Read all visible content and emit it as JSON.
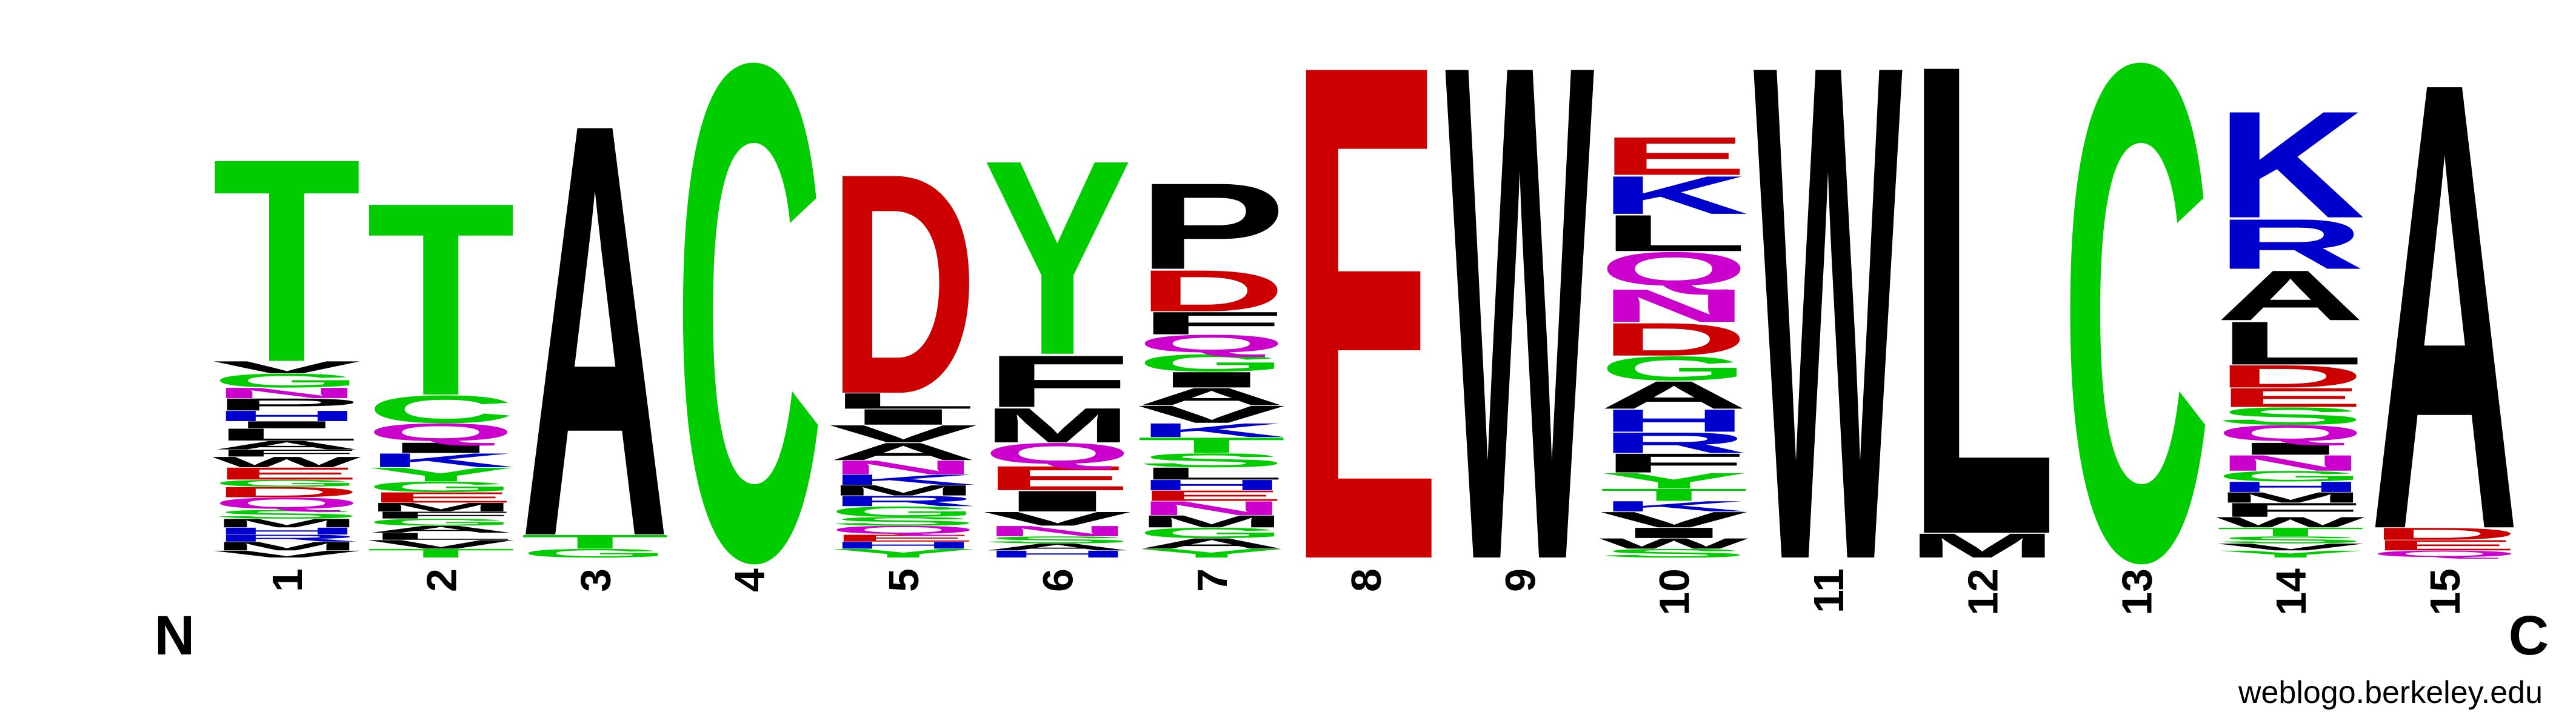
{
  "logo": {
    "n_terminus": "N",
    "c_terminus": "C",
    "credit": "weblogo.berkeley.edu",
    "colors": {
      "hydrophobic": "#000000",
      "polar": "#00cc00",
      "acidic": "#cc0000",
      "basic": "#0000cc",
      "amide": "#cc00cc"
    },
    "color_map": {
      "A": "#000000",
      "V": "#000000",
      "L": "#000000",
      "I": "#000000",
      "P": "#000000",
      "W": "#000000",
      "F": "#000000",
      "M": "#000000",
      "G": "#00cc00",
      "S": "#00cc00",
      "T": "#00cc00",
      "Y": "#00cc00",
      "C": "#00cc00",
      "D": "#cc0000",
      "E": "#cc0000",
      "K": "#0000cc",
      "R": "#0000cc",
      "H": "#0000cc",
      "N": "#cc00cc",
      "Q": "#cc00cc"
    },
    "positions": [
      {
        "label": "1",
        "stack": [
          {
            "aa": "V",
            "h": 0.04
          },
          {
            "aa": "M",
            "h": 0.05
          },
          {
            "aa": "R",
            "h": 0.04
          },
          {
            "aa": "H",
            "h": 0.04
          },
          {
            "aa": "M",
            "h": 0.05
          },
          {
            "aa": "S",
            "h": 0.05
          },
          {
            "aa": "Q",
            "h": 0.07
          },
          {
            "aa": "D",
            "h": 0.06
          },
          {
            "aa": "G",
            "h": 0.04
          },
          {
            "aa": "E",
            "h": 0.07
          },
          {
            "aa": "W",
            "h": 0.06
          },
          {
            "aa": "F",
            "h": 0.04
          },
          {
            "aa": "A",
            "h": 0.05
          },
          {
            "aa": "L",
            "h": 0.07
          },
          {
            "aa": "I",
            "h": 0.04
          },
          {
            "aa": "H",
            "h": 0.06
          },
          {
            "aa": "P",
            "h": 0.07
          },
          {
            "aa": "N",
            "h": 0.06
          },
          {
            "aa": "G",
            "h": 0.08
          },
          {
            "aa": "V",
            "h": 0.07
          },
          {
            "aa": "T",
            "h": 1.18
          }
        ]
      },
      {
        "label": "2",
        "stack": [
          {
            "aa": "T",
            "h": 0.05
          },
          {
            "aa": "V",
            "h": 0.05
          },
          {
            "aa": "L",
            "h": 0.04
          },
          {
            "aa": "A",
            "h": 0.04
          },
          {
            "aa": "G",
            "h": 0.04
          },
          {
            "aa": "F",
            "h": 0.04
          },
          {
            "aa": "M",
            "h": 0.05
          },
          {
            "aa": "E",
            "h": 0.06
          },
          {
            "aa": "G",
            "h": 0.06
          },
          {
            "aa": "Y",
            "h": 0.08
          },
          {
            "aa": "K",
            "h": 0.08
          },
          {
            "aa": "I",
            "h": 0.06
          },
          {
            "aa": "Q",
            "h": 0.11
          },
          {
            "aa": "C",
            "h": 0.16
          },
          {
            "aa": "T",
            "h": 1.12
          }
        ]
      },
      {
        "label": "3",
        "stack": [
          {
            "aa": "G",
            "h": 0.05
          },
          {
            "aa": "T",
            "h": 0.08
          },
          {
            "aa": "A",
            "h": 2.4
          }
        ]
      },
      {
        "label": "4",
        "stack": [
          {
            "aa": "C",
            "h": 2.88
          }
        ]
      },
      {
        "label": "5",
        "stack": [
          {
            "aa": "Y",
            "h": 0.05
          },
          {
            "aa": "H",
            "h": 0.04
          },
          {
            "aa": "E",
            "h": 0.04
          },
          {
            "aa": "Q",
            "h": 0.05
          },
          {
            "aa": "S",
            "h": 0.05
          },
          {
            "aa": "G",
            "h": 0.06
          },
          {
            "aa": "R",
            "h": 0.06
          },
          {
            "aa": "M",
            "h": 0.06
          },
          {
            "aa": "K",
            "h": 0.06
          },
          {
            "aa": "N",
            "h": 0.08
          },
          {
            "aa": "A",
            "h": 0.1
          },
          {
            "aa": "V",
            "h": 0.1
          },
          {
            "aa": "I",
            "h": 0.09
          },
          {
            "aa": "L",
            "h": 0.09
          },
          {
            "aa": "D",
            "h": 1.28
          }
        ]
      },
      {
        "label": "6",
        "stack": [
          {
            "aa": "H",
            "h": 0.04
          },
          {
            "aa": "A",
            "h": 0.04
          },
          {
            "aa": "S",
            "h": 0.04
          },
          {
            "aa": "N",
            "h": 0.06
          },
          {
            "aa": "V",
            "h": 0.08
          },
          {
            "aa": "I",
            "h": 0.12
          },
          {
            "aa": "E",
            "h": 0.14
          },
          {
            "aa": "Q",
            "h": 0.13
          },
          {
            "aa": "M",
            "h": 0.2
          },
          {
            "aa": "F",
            "h": 0.3
          },
          {
            "aa": "Y",
            "h": 1.13
          }
        ]
      },
      {
        "label": "7",
        "stack": [
          {
            "aa": "Y",
            "h": 0.05
          },
          {
            "aa": "A",
            "h": 0.06
          },
          {
            "aa": "G",
            "h": 0.06
          },
          {
            "aa": "M",
            "h": 0.07
          },
          {
            "aa": "N",
            "h": 0.08
          },
          {
            "aa": "E",
            "h": 0.06
          },
          {
            "aa": "H",
            "h": 0.06
          },
          {
            "aa": "L",
            "h": 0.07
          },
          {
            "aa": "S",
            "h": 0.08
          },
          {
            "aa": "T",
            "h": 0.09
          },
          {
            "aa": "K",
            "h": 0.08
          },
          {
            "aa": "V",
            "h": 0.1
          },
          {
            "aa": "A",
            "h": 0.1
          },
          {
            "aa": "I",
            "h": 0.09
          },
          {
            "aa": "G",
            "h": 0.1
          },
          {
            "aa": "Q",
            "h": 0.11
          },
          {
            "aa": "F",
            "h": 0.13
          },
          {
            "aa": "D",
            "h": 0.24
          },
          {
            "aa": "P",
            "h": 0.5
          }
        ]
      },
      {
        "label": "8",
        "stack": [
          {
            "aa": "E",
            "h": 2.88
          }
        ]
      },
      {
        "label": "9",
        "stack": [
          {
            "aa": "W",
            "h": 2.88
          }
        ]
      },
      {
        "label": "10",
        "stack": [
          {
            "aa": "S",
            "h": 0.05
          },
          {
            "aa": "W",
            "h": 0.06
          },
          {
            "aa": "I",
            "h": 0.06
          },
          {
            "aa": "V",
            "h": 0.09
          },
          {
            "aa": "K",
            "h": 0.06
          },
          {
            "aa": "T",
            "h": 0.07
          },
          {
            "aa": "Y",
            "h": 0.09
          },
          {
            "aa": "F",
            "h": 0.11
          },
          {
            "aa": "R",
            "h": 0.12
          },
          {
            "aa": "H",
            "h": 0.13
          },
          {
            "aa": "A",
            "h": 0.16
          },
          {
            "aa": "G",
            "h": 0.14
          },
          {
            "aa": "D",
            "h": 0.19
          },
          {
            "aa": "N",
            "h": 0.19
          },
          {
            "aa": "Q",
            "h": 0.21
          },
          {
            "aa": "L",
            "h": 0.21
          },
          {
            "aa": "K",
            "h": 0.22
          },
          {
            "aa": "E",
            "h": 0.22
          }
        ]
      },
      {
        "label": "11",
        "stack": [
          {
            "aa": "W",
            "h": 2.88
          }
        ]
      },
      {
        "label": "12",
        "stack": [
          {
            "aa": "M",
            "h": 0.14
          },
          {
            "aa": "L",
            "h": 2.74
          }
        ]
      },
      {
        "label": "13",
        "stack": [
          {
            "aa": "C",
            "h": 2.88
          }
        ]
      },
      {
        "label": "14",
        "stack": [
          {
            "aa": "Y",
            "h": 0.04
          },
          {
            "aa": "V",
            "h": 0.04
          },
          {
            "aa": "S",
            "h": 0.04
          },
          {
            "aa": "T",
            "h": 0.05
          },
          {
            "aa": "W",
            "h": 0.06
          },
          {
            "aa": "F",
            "h": 0.08
          },
          {
            "aa": "M",
            "h": 0.06
          },
          {
            "aa": "H",
            "h": 0.06
          },
          {
            "aa": "G",
            "h": 0.06
          },
          {
            "aa": "N",
            "h": 0.09
          },
          {
            "aa": "I",
            "h": 0.07
          },
          {
            "aa": "Q",
            "h": 0.1
          },
          {
            "aa": "S",
            "h": 0.1
          },
          {
            "aa": "E",
            "h": 0.11
          },
          {
            "aa": "D",
            "h": 0.13
          },
          {
            "aa": "L",
            "h": 0.25
          },
          {
            "aa": "A",
            "h": 0.29
          },
          {
            "aa": "R",
            "h": 0.29
          },
          {
            "aa": "K",
            "h": 0.62
          }
        ]
      },
      {
        "label": "15",
        "stack": [
          {
            "aa": "Q",
            "h": 0.04
          },
          {
            "aa": "E",
            "h": 0.06
          },
          {
            "aa": "D",
            "h": 0.07
          },
          {
            "aa": "A",
            "h": 2.6
          }
        ]
      }
    ]
  }
}
